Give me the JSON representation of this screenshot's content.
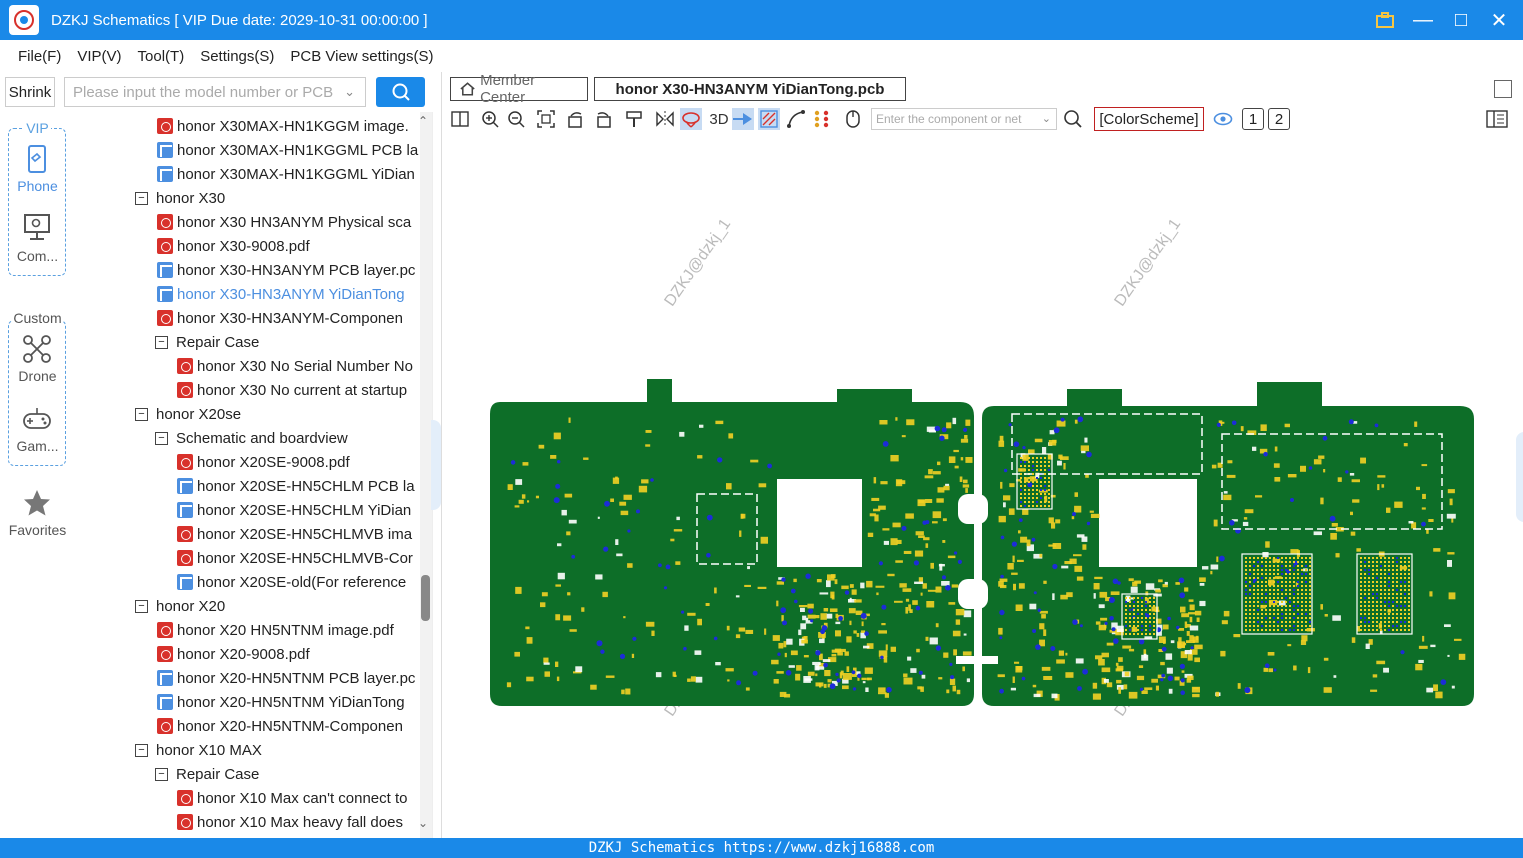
{
  "window": {
    "title": "DZKJ Schematics [ VIP Due date: 2029-10-31 00:00:00 ]"
  },
  "menu": [
    "File(F)",
    "VIP(V)",
    "Tool(T)",
    "Settings(S)",
    "PCB View settings(S)"
  ],
  "left_top": {
    "shrink_label": "Shrink",
    "search_placeholder": "Please input the model number or PCB"
  },
  "categories": {
    "vip_label": "VIP",
    "phone_label": "Phone",
    "computer_label": "Com...",
    "custom_label": "Custom",
    "drone_label": "Drone",
    "game_label": "Gam...",
    "favorites_label": "Favorites"
  },
  "tree": [
    {
      "type": "pdf",
      "level": 2,
      "text": "honor X30MAX-HN1KGGM image."
    },
    {
      "type": "pcb",
      "level": 2,
      "text": "honor X30MAX-HN1KGGML PCB la"
    },
    {
      "type": "pcb",
      "level": 2,
      "text": "honor X30MAX-HN1KGGML YiDian"
    },
    {
      "type": "folder",
      "level": 1,
      "text": "honor X30",
      "expanded": true
    },
    {
      "type": "pdf",
      "level": 2,
      "text": "honor X30 HN3ANYM Physical sca"
    },
    {
      "type": "pdf",
      "level": 2,
      "text": "honor X30-9008.pdf"
    },
    {
      "type": "pcb",
      "level": 2,
      "text": "honor X30-HN3ANYM PCB layer.pc"
    },
    {
      "type": "pcb",
      "level": 2,
      "text": "honor X30-HN3ANYM YiDianTong",
      "selected": true
    },
    {
      "type": "pdf",
      "level": 2,
      "text": "honor X30-HN3ANYM-Componen"
    },
    {
      "type": "folder",
      "level": 2,
      "text": "Repair Case",
      "expanded": true
    },
    {
      "type": "pdf",
      "level": 3,
      "text": "honor X30 No Serial Number No"
    },
    {
      "type": "pdf",
      "level": 3,
      "text": "honor X30 No current at startup"
    },
    {
      "type": "folder",
      "level": 1,
      "text": "honor X20se",
      "expanded": true
    },
    {
      "type": "folder",
      "level": 2,
      "text": "Schematic and boardview",
      "expanded": true
    },
    {
      "type": "pdf",
      "level": 3,
      "text": "honor X20SE-9008.pdf"
    },
    {
      "type": "pcb",
      "level": 3,
      "text": "honor X20SE-HN5CHLM PCB la"
    },
    {
      "type": "pcb",
      "level": 3,
      "text": "honor X20SE-HN5CHLM YiDian"
    },
    {
      "type": "pdf",
      "level": 3,
      "text": "honor X20SE-HN5CHLMVB ima"
    },
    {
      "type": "pdf",
      "level": 3,
      "text": "honor X20SE-HN5CHLMVB-Cor"
    },
    {
      "type": "pcb",
      "level": 3,
      "text": "honor X20SE-old(For reference"
    },
    {
      "type": "folder",
      "level": 1,
      "text": "honor X20",
      "expanded": true
    },
    {
      "type": "pdf",
      "level": 2,
      "text": "honor X20 HN5NTNM image.pdf"
    },
    {
      "type": "pdf",
      "level": 2,
      "text": "honor X20-9008.pdf"
    },
    {
      "type": "pcb",
      "level": 2,
      "text": "honor X20-HN5NTNM PCB layer.pc"
    },
    {
      "type": "pcb",
      "level": 2,
      "text": "honor X20-HN5NTNM YiDianTong"
    },
    {
      "type": "pdf",
      "level": 2,
      "text": "honor X20-HN5NTNM-Componen"
    },
    {
      "type": "folder",
      "level": 1,
      "text": "honor X10 MAX",
      "expanded": true
    },
    {
      "type": "folder",
      "level": 2,
      "text": "Repair Case",
      "expanded": true
    },
    {
      "type": "pdf",
      "level": 3,
      "text": "honor X10 Max can't connect to"
    },
    {
      "type": "pdf",
      "level": 3,
      "text": "honor X10 Max heavy fall does"
    }
  ],
  "tabs": {
    "member_center": "Member Center",
    "active_file": "honor X30-HN3ANYM YiDianTong.pcb"
  },
  "toolbar": {
    "three_d_label": "3D",
    "component_search_placeholder": "Enter the component or net",
    "color_scheme_label": "[ColorScheme]",
    "layer1": "1",
    "layer2": "2"
  },
  "watermark": "DZKJ@dzkj_1",
  "status_bar": "DZKJ Schematics https://www.dzkj16888.com",
  "colors": {
    "accent": "#1a89e8",
    "pcb_green": "#0d6e28",
    "pad_yellow": "#f2d024",
    "via_blue": "#1c2cd8"
  }
}
